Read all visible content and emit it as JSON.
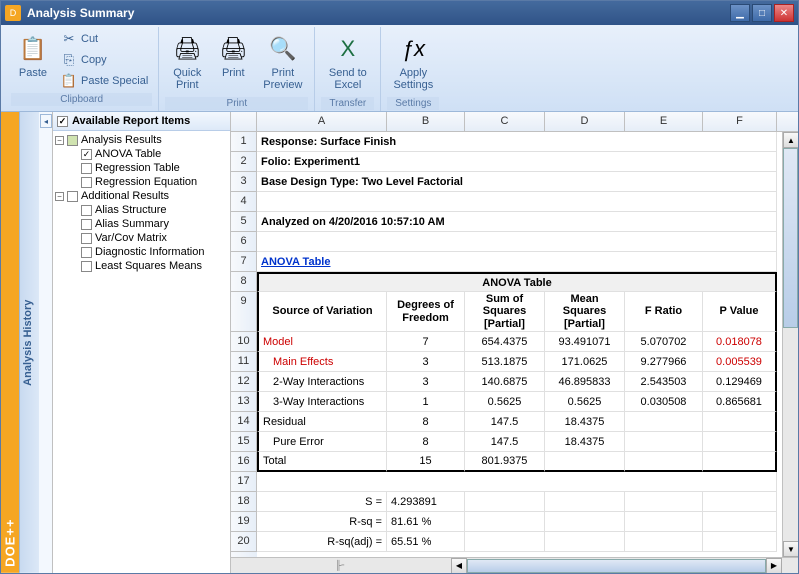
{
  "window": {
    "title": "Analysis Summary"
  },
  "ribbon": {
    "clipboard": {
      "label": "Clipboard",
      "paste": "Paste",
      "cut": "Cut",
      "copy": "Copy",
      "paste_special": "Paste Special"
    },
    "print": {
      "label": "Print",
      "quick_print": "Quick\nPrint",
      "print": "Print",
      "print_preview": "Print\nPreview"
    },
    "transfer": {
      "label": "Transfer",
      "send_excel": "Send to\nExcel"
    },
    "settings": {
      "label": "Settings",
      "apply": "Apply\nSettings"
    }
  },
  "history_label": "Analysis History",
  "brand": "DOE++",
  "tree": {
    "header": "Available Report Items",
    "g1": "Analysis Results",
    "g1_items": [
      "ANOVA Table",
      "Regression Table",
      "Regression Equation"
    ],
    "g2": "Additional Results",
    "g2_items": [
      "Alias Structure",
      "Alias Summary",
      "Var/Cov Matrix",
      "Diagnostic Information",
      "Least Squares Means"
    ]
  },
  "sheet": {
    "cols": [
      "A",
      "B",
      "C",
      "D",
      "E",
      "F"
    ],
    "info": {
      "response": "Response: Surface Finish",
      "folio": "Folio: Experiment1",
      "design": "Base Design Type: Two Level Factorial",
      "analyzed": "Analyzed on 4/20/2016 10:57:10 AM",
      "anova_link": "ANOVA Table"
    },
    "anova": {
      "title": "ANOVA Table",
      "headers": [
        "Source of Variation",
        "Degrees of Freedom",
        "Sum of Squares [Partial]",
        "Mean Squares [Partial]",
        "F Ratio",
        "P Value"
      ],
      "rows": [
        {
          "src": "Model",
          "df": "7",
          "ss": "654.4375",
          "ms": "93.491071",
          "f": "5.070702",
          "p": "0.018078",
          "red": true,
          "indent": 0
        },
        {
          "src": "Main Effects",
          "df": "3",
          "ss": "513.1875",
          "ms": "171.0625",
          "f": "9.277966",
          "p": "0.005539",
          "red": true,
          "indent": 1
        },
        {
          "src": "2-Way Interactions",
          "df": "3",
          "ss": "140.6875",
          "ms": "46.895833",
          "f": "2.543503",
          "p": "0.129469",
          "indent": 1
        },
        {
          "src": "3-Way Interactions",
          "df": "1",
          "ss": "0.5625",
          "ms": "0.5625",
          "f": "0.030508",
          "p": "0.865681",
          "indent": 1
        },
        {
          "src": "Residual",
          "df": "8",
          "ss": "147.5",
          "ms": "18.4375",
          "f": "",
          "p": "",
          "indent": 0
        },
        {
          "src": "Pure Error",
          "df": "8",
          "ss": "147.5",
          "ms": "18.4375",
          "f": "",
          "p": "",
          "indent": 1
        },
        {
          "src": "Total",
          "df": "15",
          "ss": "801.9375",
          "ms": "",
          "f": "",
          "p": "",
          "indent": 0
        }
      ]
    },
    "stats": [
      {
        "label": "S =",
        "val": "4.293891"
      },
      {
        "label": "R-sq =",
        "val": "81.61 %"
      },
      {
        "label": "R-sq(adj) =",
        "val": "65.51 %"
      }
    ]
  },
  "chart_data": {
    "type": "table",
    "title": "ANOVA Table",
    "columns": [
      "Source of Variation",
      "Degrees of Freedom",
      "Sum of Squares [Partial]",
      "Mean Squares [Partial]",
      "F Ratio",
      "P Value"
    ],
    "rows": [
      [
        "Model",
        7,
        654.4375,
        93.491071,
        5.070702,
        0.018078
      ],
      [
        "Main Effects",
        3,
        513.1875,
        171.0625,
        9.277966,
        0.005539
      ],
      [
        "2-Way Interactions",
        3,
        140.6875,
        46.895833,
        2.543503,
        0.129469
      ],
      [
        "3-Way Interactions",
        1,
        0.5625,
        0.5625,
        0.030508,
        0.865681
      ],
      [
        "Residual",
        8,
        147.5,
        18.4375,
        null,
        null
      ],
      [
        "Pure Error",
        8,
        147.5,
        18.4375,
        null,
        null
      ],
      [
        "Total",
        15,
        801.9375,
        null,
        null,
        null
      ]
    ],
    "summary": {
      "S": 4.293891,
      "R-sq": "81.61 %",
      "R-sq(adj)": "65.51 %"
    }
  }
}
